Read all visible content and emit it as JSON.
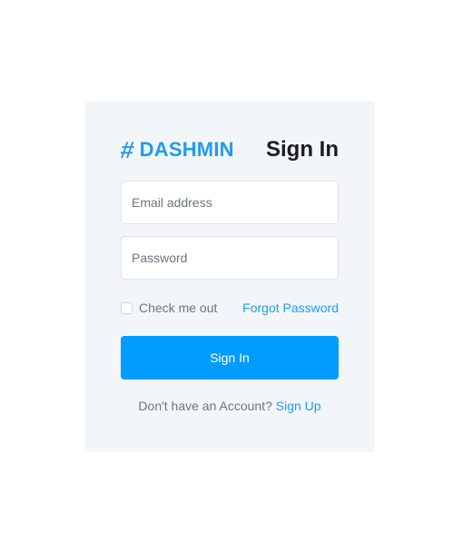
{
  "brand": {
    "icon": "hashtag-icon",
    "icon_glyph": "#",
    "name": "DASHMIN"
  },
  "page_title": "Sign In",
  "form": {
    "email_placeholder": "Email address",
    "password_placeholder": "Password",
    "remember_label": "Check me out",
    "remember_checked": false,
    "forgot_label": "Forgot Password",
    "submit_label": "Sign In"
  },
  "footer": {
    "prompt": "Don't have an Account? ",
    "signup_label": "Sign Up"
  },
  "colors": {
    "accent": "#009cff",
    "brand": "#1f9cf0",
    "card_background": "#f3f6f9",
    "heading": "#191c24",
    "muted_text": "#6c757d"
  }
}
